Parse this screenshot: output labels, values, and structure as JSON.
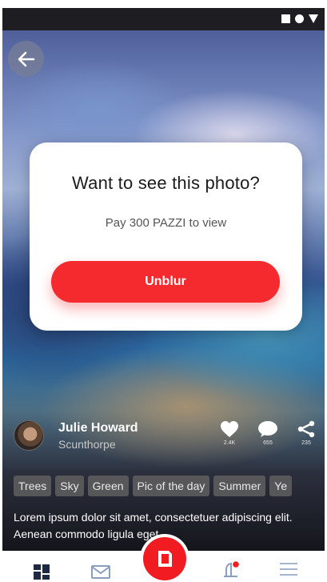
{
  "modal": {
    "title": "Want to see this photo?",
    "subtitle": "Pay 300 PAZZI to view",
    "button_label": "Unblur"
  },
  "author": {
    "name": "Julie Howard",
    "location": "Scunthorpe"
  },
  "actions": {
    "likes": "2.4K",
    "comments": "655",
    "shares": "235"
  },
  "tags": [
    "Trees",
    "Sky",
    "Green",
    "Pic of the day",
    "Summer",
    "Ye"
  ],
  "caption": "Lorem ipsum dolor sit amet, consectetuer adipiscing elit. Aenean commodo ligula eget",
  "nav": {
    "items": [
      "dashboard-icon",
      "mail-icon",
      "record-icon",
      "notification-icon",
      "menu-icon"
    ]
  },
  "colors": {
    "accent": "#f52a2f",
    "status_bar": "#1d1d22",
    "notification_dot": "#f11b22"
  }
}
